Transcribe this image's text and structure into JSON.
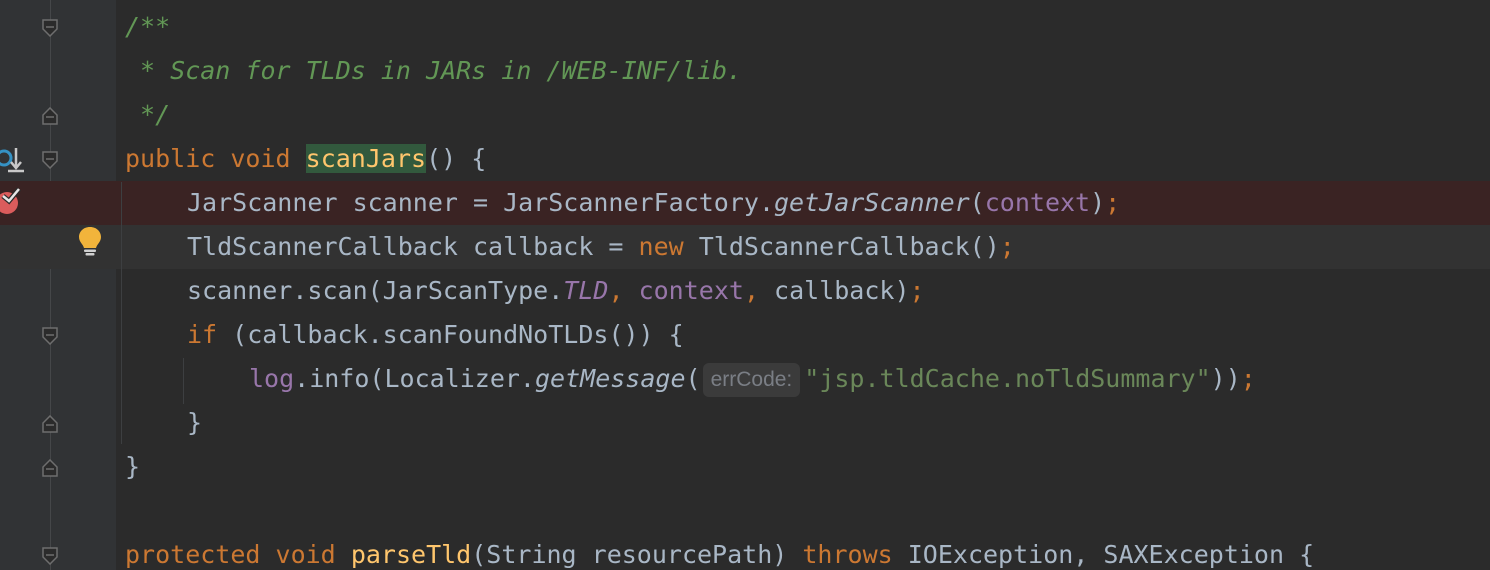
{
  "editor": {
    "language": "java",
    "lines": {
      "doc_open": "/**",
      "doc_body": " * Scan for TLDs in JARs in /WEB-INF/lib.",
      "doc_close": " */",
      "l4": {
        "kw1": "public",
        "kw2": "void",
        "method": "scanJars",
        "rest": "() {"
      },
      "l5": {
        "a": "JarScanner scanner = JarScannerFactory.",
        "call": "getJarScanner",
        "paren": "(",
        "field": "context",
        "close": ")",
        "semi": ";"
      },
      "l6": {
        "a": "TldScannerCallback callback = ",
        "kw": "new",
        "b": " TldScannerCallback()",
        "semi": ";"
      },
      "l7": {
        "a": "scanner.scan(JarScanType.",
        "const": "TLD",
        "comma1": ",",
        "space": " ",
        "field": "context",
        "comma2": ",",
        "b": " callback)",
        "semi": ";"
      },
      "l8": {
        "kw": "if",
        "rest": " (callback.scanFoundNoTLDs()) {"
      },
      "l9": {
        "field": "log",
        "a": ".info(Localizer.",
        "call": "getMessage",
        "paren": "(",
        "hint": "errCode:",
        "str": "\"jsp.tldCache.noTldSummary\"",
        "close": "))",
        "semi": ";"
      },
      "l10": "}",
      "l11": "}",
      "l13": {
        "kw1": "protected",
        "kw2": "void",
        "method": "parseTld",
        "a": "(String resourcePath) ",
        "kw3": "throws",
        "b": " IOException, SAXException {"
      }
    }
  },
  "colors": {
    "background": "#2b2b2b",
    "keyword": "#cc7832",
    "comment": "#629755",
    "method_decl": "#ffc66d",
    "field": "#9876aa",
    "string": "#6a8759",
    "breakpoint_line": "#3a2323",
    "breakpoint_icon": "#db5c5c"
  },
  "gutter_icons": {
    "line4": "implemented-method-icon",
    "line5": "breakpoint-icon",
    "line6": "lightbulb-icon"
  }
}
